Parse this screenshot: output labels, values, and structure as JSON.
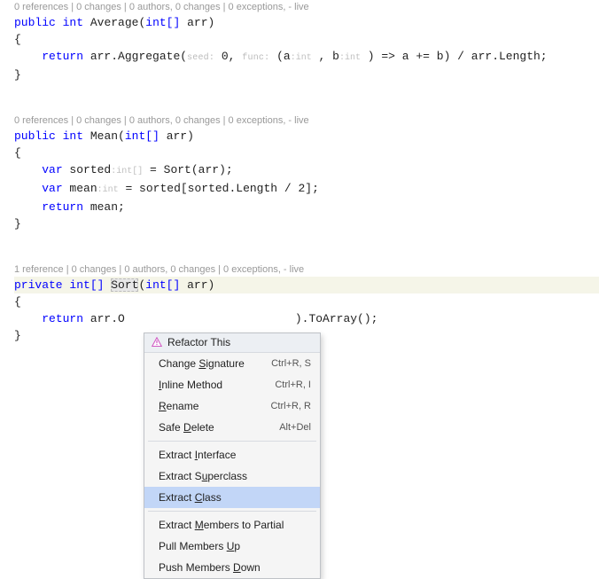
{
  "codelens": {
    "average": "0 references | 0 changes | 0 authors, 0 changes | 0 exceptions, - live",
    "mean": "0 references | 0 changes | 0 authors, 0 changes | 0 exceptions, - live",
    "sort": "1 reference | 0 changes | 0 authors, 0 changes | 0 exceptions, - live"
  },
  "methods": {
    "average": {
      "modifier": "public",
      "return_type": "int",
      "name": "Average",
      "param_type": "int[]",
      "param_name": "arr",
      "body": {
        "return_kw": "return",
        "expr_prefix": " arr.Aggregate(",
        "hint_seed_label": "seed:",
        "seed_val": " 0, ",
        "hint_func_label": "func:",
        "lambda_open": " (a",
        "a_hint": ":int",
        "mid": " , b",
        "b_hint": ":int",
        "lambda_close": " ) => a += b) / arr.Length;"
      }
    },
    "mean": {
      "modifier": "public",
      "return_type": "int",
      "name": "Mean",
      "param_type": "int[]",
      "param_name": "arr",
      "line1": {
        "var": "var",
        "ident": " sorted",
        "hint": ":int[]",
        "rest": " = Sort(arr);"
      },
      "line2": {
        "var": "var",
        "ident": " mean",
        "hint": ":int",
        "rest": " = sorted[sorted.Length / 2];"
      },
      "line3": {
        "return_kw": "return",
        "rest": " mean;"
      }
    },
    "sort": {
      "modifier": "private",
      "return_type": "int[]",
      "name": "Sort",
      "param_type": "int[]",
      "param_name": "arr",
      "body": {
        "return_kw": "return",
        "prefix": " arr.O",
        "suffix": ").ToArray();"
      }
    }
  },
  "braces": {
    "open": "{",
    "close": "}"
  },
  "menu": {
    "title": "Refactor This",
    "items": [
      {
        "label": "Change Signature",
        "shortcut": "Ctrl+R, S",
        "mn": "S"
      },
      {
        "label": "Inline Method",
        "shortcut": "Ctrl+R, I",
        "mn": "I"
      },
      {
        "label": "Rename",
        "shortcut": "Ctrl+R, R",
        "mn": "R"
      },
      {
        "label": "Safe Delete",
        "shortcut": "Alt+Del",
        "mn": "D"
      }
    ],
    "group2": [
      {
        "label": "Extract Interface",
        "mn": "I"
      },
      {
        "label": "Extract Superclass",
        "mn": "u"
      },
      {
        "label": "Extract Class",
        "mn": "C",
        "selected": true
      }
    ],
    "group3": [
      {
        "label": "Extract Members to Partial",
        "mn": "M"
      },
      {
        "label": "Pull Members Up",
        "mn": "U"
      },
      {
        "label": "Push Members Down",
        "mn": "D"
      }
    ]
  }
}
